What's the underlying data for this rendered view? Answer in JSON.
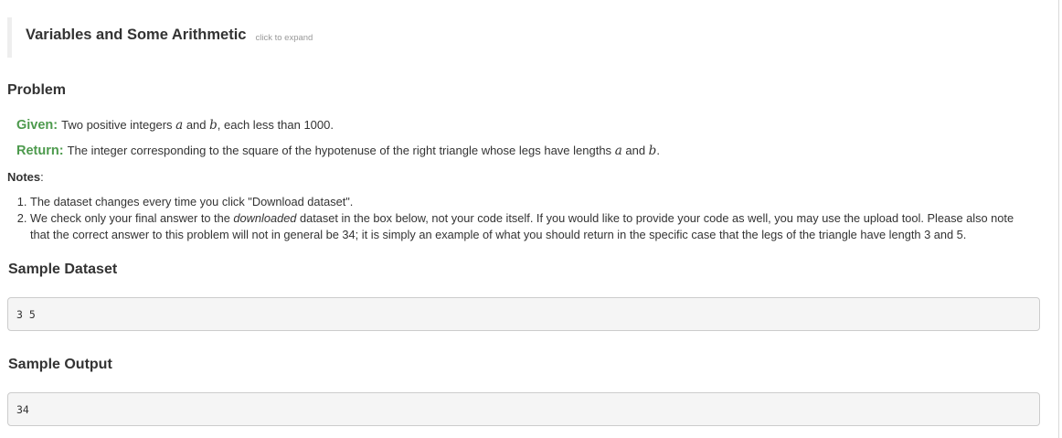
{
  "collapse": {
    "title": "Variables and Some Arithmetic",
    "hint": "click to expand"
  },
  "problem": {
    "heading": "Problem",
    "given": {
      "label": "Given:",
      "text_1": "Two positive integers ",
      "var_a": "a",
      "text_2": " and ",
      "var_b": "b",
      "text_3": ", each less than 1000."
    },
    "return": {
      "label": "Return:",
      "text_1": "The integer corresponding to the square of the hypotenuse of the right triangle whose legs have lengths ",
      "var_a": "a",
      "text_2": " and ",
      "var_b": "b",
      "text_3": "."
    }
  },
  "notes": {
    "label": "Notes",
    "colon": ":",
    "items": [
      {
        "text": "The dataset changes every time you click \"Download dataset\"."
      },
      {
        "text_1": "We check only your final answer to the ",
        "emph": "downloaded",
        "text_2": " dataset in the box below, not your code itself. If you would like to provide your code as well, you may use the upload tool. Please also note that the correct answer to this problem will not in general be 34; it is simply an example of what you should return in the specific case that the legs of the triangle have length 3 and 5."
      }
    ]
  },
  "sample_dataset": {
    "heading": "Sample Dataset",
    "content": "3 5"
  },
  "sample_output": {
    "heading": "Sample Output",
    "content": "34"
  }
}
